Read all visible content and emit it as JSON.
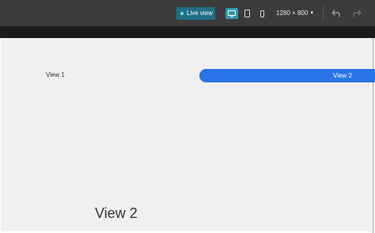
{
  "toolbar": {
    "live_view_label": "Live view",
    "size_label": "1280 × 800",
    "icons": {
      "live": "live-dot-icon",
      "desktop": "desktop-icon",
      "tablet": "tablet-icon",
      "mobile": "mobile-icon",
      "dropdown": "chevron-down-icon",
      "undo": "undo-icon",
      "redo": "redo-icon"
    },
    "colors": {
      "background": "#3b3b3b",
      "live_view_bg": "#1f6f86",
      "active_device_bg": "#2f97b1"
    }
  },
  "canvas": {
    "tabs": [
      {
        "label": "View 1",
        "active": false
      },
      {
        "label": "View 2",
        "active": true
      }
    ],
    "heading": "View 2",
    "colors": {
      "background": "#f0f0f0",
      "active_tab": "#2a73e6"
    }
  }
}
